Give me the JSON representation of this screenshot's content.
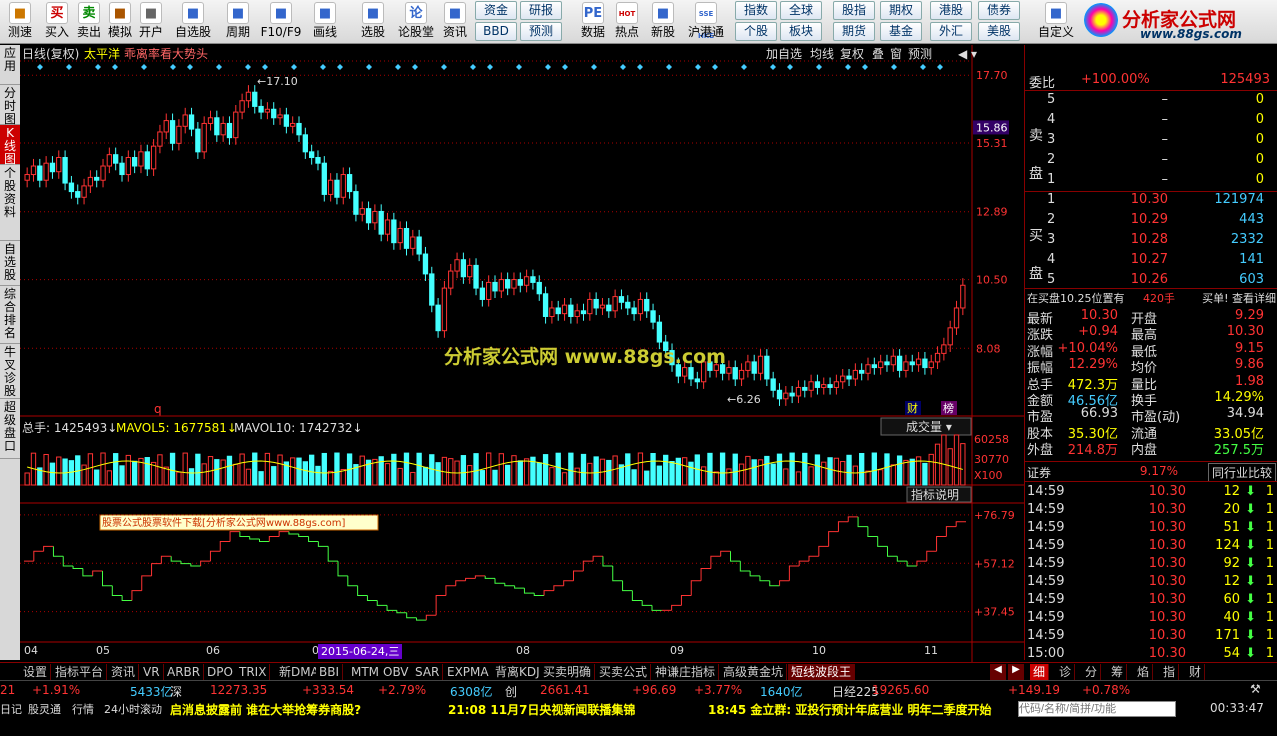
{
  "toolbar": {
    "items": [
      {
        "label": "测速",
        "icon": "speed-test-icon",
        "color": "#c70"
      },
      {
        "label": "买入",
        "icon": "buy-icon",
        "color": "#c00",
        "glyph": "买"
      },
      {
        "label": "卖出",
        "icon": "sell-icon",
        "color": "#080",
        "glyph": "卖"
      },
      {
        "label": "模拟",
        "icon": "hammer-icon",
        "color": "#a50"
      },
      {
        "label": "开户",
        "icon": "lock-icon",
        "color": "#666"
      },
      {
        "label": "自选股",
        "icon": "watchlist-icon",
        "color": "#36c"
      },
      {
        "label": "周期",
        "icon": "clock-icon",
        "color": "#36c"
      },
      {
        "label": "F10/F9",
        "icon": "f10-icon",
        "color": "#36c"
      },
      {
        "label": "画线",
        "icon": "pencil-icon",
        "color": "#36c"
      },
      {
        "label": "选股",
        "icon": "screener-icon",
        "color": "#36c"
      },
      {
        "label": "论股堂",
        "icon": "forum-icon",
        "color": "#36c",
        "glyph": "论"
      },
      {
        "label": "资讯",
        "icon": "news-icon",
        "color": "#36c"
      },
      {
        "label": "数据",
        "icon": "pe-icon",
        "color": "#36c",
        "glyph": "PE"
      },
      {
        "label": "热点",
        "icon": "hot-icon",
        "color": "#c00",
        "glyph": "HOT"
      },
      {
        "label": "新股",
        "icon": "ipo-icon",
        "color": "#36c"
      },
      {
        "label": "沪港通",
        "icon": "hk-connect-icon",
        "color": "#36c",
        "glyph": "SSE HKE"
      },
      {
        "label": "自定义",
        "icon": "customize-icon",
        "color": "#36c"
      }
    ],
    "quick_top": [
      "资金",
      "研报",
      "指数",
      "全球",
      "股指",
      "期权",
      "港股",
      "债券"
    ],
    "quick_bottom": [
      "BBD",
      "预测",
      "个股",
      "板块",
      "期货",
      "基金",
      "外汇",
      "美股"
    ]
  },
  "logo": {
    "text": "分析家公式网",
    "url": "www.88gs.com"
  },
  "left_tabs": [
    "应用",
    "分时图",
    "K线图",
    "个股资料",
    "自选股",
    "综合排名",
    "牛叉诊股",
    "超级盘口"
  ],
  "chart": {
    "header_left": "日线(复权)",
    "stock_name": "太平洋",
    "indicator_title": "乖离率看大势头",
    "top_buttons": [
      "加自选",
      "均线",
      "复权",
      "叠",
      "窗",
      "预测"
    ],
    "price_axis": [
      "17.70",
      "15.31",
      "12.89",
      "10.50",
      "8.08"
    ],
    "current_price_tag": "15.86",
    "high_label": "17.10",
    "low_label": "6.26",
    "marker_q": "q",
    "marker_cai": "财",
    "marker_bang": "榜",
    "watermark": "分析家公式网  www.88gs.com",
    "vol_title": "总手: 1425493",
    "mavol5": "MAVOL5: 1677581",
    "mavol10": "MAVOL10: 1742732",
    "vol_select": "成交量",
    "vol_axis": [
      "60258",
      "30770",
      "X100"
    ],
    "ind_button": "指标说明",
    "ind_label": "股票公式股票软件下载[分析家公式网www.88gs.com]",
    "ind_axis": [
      "+76.79",
      "+57.12",
      "+37.45"
    ],
    "date_axis": [
      "04",
      "05",
      "06",
      "07",
      "08",
      "09",
      "10",
      "11"
    ],
    "date_highlight": "2015-06-24,三"
  },
  "chart_data": {
    "type": "candlestick",
    "price_range": [
      5.8,
      18.2
    ],
    "closes": [
      14.2,
      14.5,
      14.0,
      14.6,
      14.3,
      14.8,
      13.9,
      13.6,
      13.4,
      13.8,
      14.1,
      14.0,
      14.5,
      14.9,
      14.6,
      14.2,
      14.8,
      14.5,
      15.0,
      14.4,
      15.2,
      15.7,
      16.1,
      15.3,
      15.9,
      16.3,
      15.8,
      15.0,
      16.0,
      16.2,
      15.6,
      16.0,
      15.5,
      16.4,
      16.8,
      17.1,
      16.6,
      16.4,
      16.5,
      16.2,
      16.3,
      15.9,
      16.0,
      15.6,
      15.0,
      14.8,
      14.6,
      13.5,
      14.0,
      13.4,
      14.2,
      13.6,
      12.8,
      13.0,
      12.5,
      12.9,
      12.1,
      12.6,
      11.8,
      12.3,
      11.6,
      12.0,
      11.4,
      10.7,
      9.6,
      8.7,
      10.2,
      10.8,
      11.2,
      10.6,
      11.0,
      10.2,
      9.8,
      10.4,
      10.1,
      10.5,
      10.2,
      10.5,
      10.3,
      10.6,
      10.4,
      10.0,
      9.2,
      9.5,
      9.3,
      9.6,
      9.2,
      9.4,
      9.3,
      9.8,
      9.5,
      9.6,
      9.4,
      9.9,
      9.7,
      9.5,
      9.3,
      9.8,
      9.4,
      9.0,
      8.3,
      8.0,
      7.5,
      7.1,
      7.4,
      7.0,
      6.9,
      7.6,
      7.3,
      7.5,
      7.2,
      7.4,
      7.0,
      7.3,
      7.6,
      7.2,
      7.8,
      7.0,
      6.6,
      6.3,
      6.5,
      6.4,
      6.7,
      6.6,
      6.9,
      6.7,
      6.8,
      6.7,
      6.9,
      7.1,
      7.0,
      7.3,
      7.2,
      7.5,
      7.4,
      7.6,
      7.5,
      7.8,
      7.3,
      7.6,
      7.5,
      7.7,
      7.4,
      7.6,
      7.9,
      8.2,
      8.8,
      9.5,
      10.3
    ],
    "ind_range": [
      30,
      80
    ],
    "ind_values": [
      58,
      62,
      64,
      60,
      56,
      55,
      52,
      54,
      48,
      44,
      42,
      46,
      52,
      57,
      60,
      58,
      57,
      56,
      58,
      62,
      66,
      70,
      68,
      67,
      66,
      68,
      70,
      69,
      68,
      66,
      64,
      58,
      52,
      48,
      44,
      42,
      40,
      38,
      37,
      35,
      34,
      36,
      44,
      48,
      50,
      51,
      52,
      51,
      49,
      48,
      47,
      45,
      44,
      46,
      48,
      50,
      54,
      58,
      60,
      56,
      50,
      46,
      42,
      40,
      38,
      38,
      40,
      44,
      50,
      55,
      60,
      62,
      58,
      54,
      52,
      50,
      48,
      50,
      56,
      58,
      60,
      64,
      70,
      74,
      76,
      72,
      68,
      64,
      60,
      58,
      56,
      58,
      62,
      68,
      72,
      74
    ],
    "volume_scale": 60258
  },
  "quote": {
    "weibi_label": "委比",
    "weibi_value": "+100.00%",
    "weibi_num": "125493",
    "sell_label": "卖盘",
    "buy_label": "买盘",
    "sells": [
      {
        "n": "5",
        "p": "–",
        "v": "0"
      },
      {
        "n": "4",
        "p": "–",
        "v": "0"
      },
      {
        "n": "3",
        "p": "–",
        "v": "0"
      },
      {
        "n": "2",
        "p": "–",
        "v": "0"
      },
      {
        "n": "1",
        "p": "–",
        "v": "0"
      }
    ],
    "buys": [
      {
        "n": "1",
        "p": "10.30",
        "v": "121974"
      },
      {
        "n": "2",
        "p": "10.29",
        "v": "443"
      },
      {
        "n": "3",
        "p": "10.28",
        "v": "2332"
      },
      {
        "n": "4",
        "p": "10.27",
        "v": "141"
      },
      {
        "n": "5",
        "p": "10.26",
        "v": "603"
      }
    ],
    "notice": "在买盘10.25位置有",
    "notice_vol": "420手",
    "notice_tail": "买单! 查看详细",
    "stats": [
      {
        "l1": "最新",
        "v1": "10.30",
        "l2": "开盘",
        "v2": "9.29",
        "c1": "#f33",
        "c2": "#f33"
      },
      {
        "l1": "涨跌",
        "v1": "+0.94",
        "l2": "最高",
        "v2": "10.30",
        "c1": "#f33",
        "c2": "#f33"
      },
      {
        "l1": "涨幅",
        "v1": "+10.04%",
        "l2": "最低",
        "v2": "9.15",
        "c1": "#f33",
        "c2": "#f33"
      },
      {
        "l1": "振幅",
        "v1": "12.29%",
        "l2": "均价",
        "v2": "9.86",
        "c1": "#f33",
        "c2": "#f33"
      },
      {
        "l1": "总手",
        "v1": "472.3万",
        "l2": "量比",
        "v2": "1.98",
        "c1": "#ff0",
        "c2": "#f33"
      },
      {
        "l1": "金额",
        "v1": "46.56亿",
        "l2": "换手",
        "v2": "14.29%",
        "c1": "#4cf",
        "c2": "#ff0"
      },
      {
        "l1": "市盈",
        "v1": "66.93",
        "l2": "市盈(动)",
        "v2": "34.94",
        "c1": "#ddd",
        "c2": "#ddd"
      },
      {
        "l1": "股本",
        "v1": "35.30亿",
        "l2": "流通",
        "v2": "33.05亿",
        "c1": "#ff0",
        "c2": "#ff0"
      },
      {
        "l1": "外盘",
        "v1": "214.8万",
        "l2": "内盘",
        "v2": "257.5万",
        "c1": "#f33",
        "c2": "#4f4"
      }
    ],
    "sector": "证券",
    "sector_pct": "9.17%",
    "compare_btn": "同行业比较",
    "ticks": [
      {
        "t": "14:59",
        "p": "10.30",
        "v": "12",
        "c": "1"
      },
      {
        "t": "14:59",
        "p": "10.30",
        "v": "20",
        "c": "1"
      },
      {
        "t": "14:59",
        "p": "10.30",
        "v": "51",
        "c": "1"
      },
      {
        "t": "14:59",
        "p": "10.30",
        "v": "124",
        "c": "1"
      },
      {
        "t": "14:59",
        "p": "10.30",
        "v": "92",
        "c": "1"
      },
      {
        "t": "14:59",
        "p": "10.30",
        "v": "12",
        "c": "1"
      },
      {
        "t": "14:59",
        "p": "10.30",
        "v": "60",
        "c": "1"
      },
      {
        "t": "14:59",
        "p": "10.30",
        "v": "40",
        "c": "1"
      },
      {
        "t": "14:59",
        "p": "10.30",
        "v": "171",
        "c": "1"
      },
      {
        "t": "15:00",
        "p": "10.30",
        "v": "54",
        "c": "1"
      }
    ],
    "right_tabs": [
      "细",
      "诊",
      "分",
      "筹",
      "焰",
      "指",
      "财"
    ]
  },
  "bottom_tabs": [
    "设置",
    "指标平台",
    "资讯",
    "VR",
    "ARBR",
    "DPO",
    "TRIX",
    "新DMA",
    "BBI",
    "MTM",
    "OBV",
    "SAR",
    "EXPMA",
    "背离KDJ",
    "买卖明确",
    "买卖公式",
    "神谦庄指标",
    "高级黄金坑",
    "短线波段王"
  ],
  "index_bar": [
    {
      "t": "21",
      "c": "#f33"
    },
    {
      "t": "+1.91%",
      "c": "#f33"
    },
    {
      "t": "5433亿",
      "c": "#4cf"
    },
    {
      "t": "深",
      "c": "#ddd"
    },
    {
      "t": "12273.35",
      "c": "#f33"
    },
    {
      "t": "+333.54",
      "c": "#f33"
    },
    {
      "t": "+2.79%",
      "c": "#f33"
    },
    {
      "t": "6308亿",
      "c": "#4cf"
    },
    {
      "t": "创",
      "c": "#ddd"
    },
    {
      "t": "2661.41",
      "c": "#f33"
    },
    {
      "t": "+96.69",
      "c": "#f33"
    },
    {
      "t": "+3.77%",
      "c": "#f33"
    },
    {
      "t": "1640亿",
      "c": "#4cf"
    },
    {
      "t": "日经225",
      "c": "#ddd"
    },
    {
      "t": "19265.60",
      "c": "#f33"
    },
    {
      "t": "+149.19",
      "c": "#f33"
    },
    {
      "t": "+0.78%",
      "c": "#f33"
    }
  ],
  "status": {
    "left": [
      "日记",
      "股灵通",
      "行情",
      "24小时滚动"
    ],
    "news1": "启消息披露前 谁在大举抢筹券商股?",
    "news2": "21:08 11月7日央视新闻联播集锦",
    "news3": "18:45 金立群: 亚投行预计年底营业 明年二季度开始",
    "search_placeholder": "代码/名称/简拼/功能",
    "time": "00:33:47"
  }
}
